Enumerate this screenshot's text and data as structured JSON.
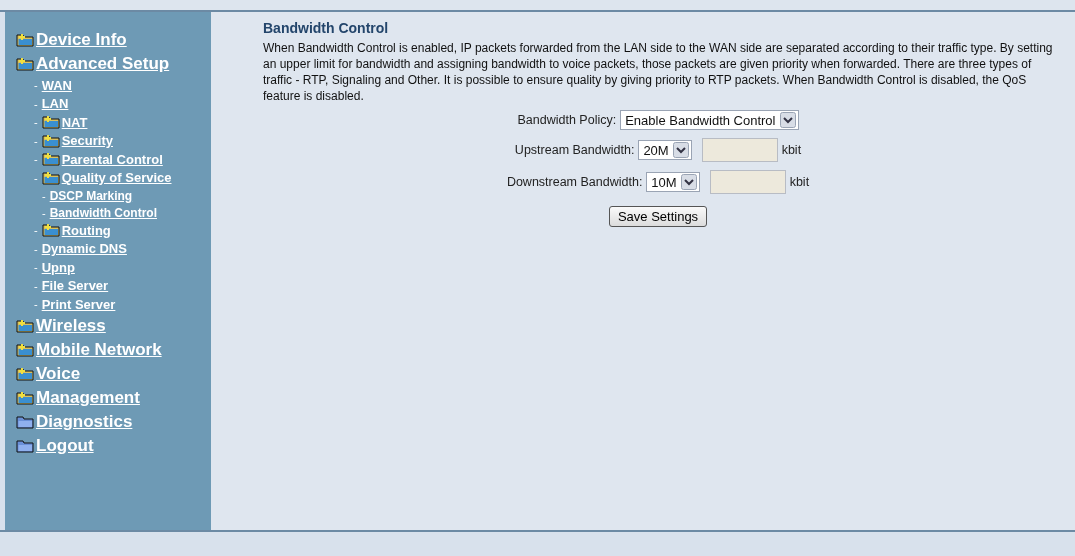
{
  "sidebar": {
    "items": [
      {
        "label": "Device Info",
        "kind": "folder-plus"
      },
      {
        "label": "Advanced Setup",
        "kind": "folder-plus",
        "children": [
          {
            "bullet": "-",
            "label": "WAN"
          },
          {
            "bullet": "-",
            "label": "LAN"
          },
          {
            "bullet": "-",
            "label": "NAT",
            "kind": "folder-plus"
          },
          {
            "bullet": "-",
            "label": "Security",
            "kind": "folder-plus"
          },
          {
            "bullet": "-",
            "label": "Parental Control",
            "kind": "folder-plus"
          },
          {
            "bullet": "-",
            "label": "Quality of Service",
            "kind": "folder-plus",
            "children": [
              {
                "bullet": "-",
                "label": "DSCP Marking"
              },
              {
                "bullet": "-",
                "label": "Bandwidth Control"
              }
            ]
          },
          {
            "bullet": "-",
            "label": "Routing",
            "kind": "folder-plus"
          },
          {
            "bullet": "-",
            "label": "Dynamic DNS"
          },
          {
            "bullet": "-",
            "label": "Upnp"
          },
          {
            "bullet": "-",
            "label": "File Server"
          },
          {
            "bullet": "-",
            "label": "Print Server"
          }
        ]
      },
      {
        "label": "Wireless",
        "kind": "folder-plus"
      },
      {
        "label": "Mobile Network",
        "kind": "folder-plus"
      },
      {
        "label": "Voice",
        "kind": "folder-plus"
      },
      {
        "label": "Management",
        "kind": "folder-plus"
      },
      {
        "label": "Diagnostics",
        "kind": "folder"
      },
      {
        "label": "Logout",
        "kind": "folder"
      }
    ]
  },
  "content": {
    "title": "Bandwidth Control",
    "description": "When Bandwidth Control is enabled, IP packets forwarded from the LAN side to the WAN side are separated according to their traffic type. By setting an upper limit for bandwidth and assigning bandwidth to voice packets, those packets are given priority when forwarded. There are three types of traffic - RTP, Signaling and Other. It is possible to ensure quality by giving priority to RTP packets. When Bandwidth Control is disabled, the QoS feature is disabled.",
    "policy": {
      "label": "Bandwidth Policy:",
      "value": "Enable Bandwidth Control"
    },
    "upstream": {
      "label": "Upstream Bandwidth:",
      "value": "20M",
      "unit": "kbit"
    },
    "downstream": {
      "label": "Downstream Bandwidth:",
      "value": "10M",
      "unit": "kbit"
    },
    "save_button": "Save Settings"
  }
}
